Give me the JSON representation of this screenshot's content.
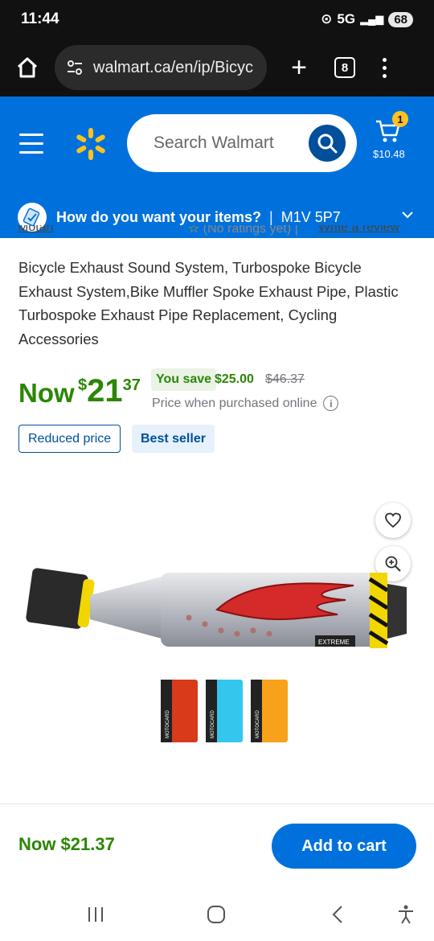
{
  "status": {
    "time": "11:44",
    "network": "5G",
    "battery": "68"
  },
  "browser": {
    "url": "walmart.ca/en/ip/Bicyc",
    "tab_count": "8"
  },
  "header": {
    "search_placeholder": "Search Walmart",
    "cart_count": "1",
    "cart_total": "$10.48",
    "brand_color": "#0071dc",
    "accent_color": "#ffc220"
  },
  "delivery": {
    "question": "How do you want your items?",
    "postal_code": "M1V 5P7"
  },
  "clipped_row": {
    "brand": "Motah",
    "ratings": "(No ratings yet)",
    "review_link": "Write a review"
  },
  "product": {
    "title": "Bicycle Exhaust Sound System, Turbospoke Bicycle Exhaust System,Bike Muffler Spoke Exhaust Pipe, Plastic Turbospoke Exhaust Pipe Replacement, Cycling Accessories",
    "now_label": "Now",
    "currency": "$",
    "price_whole": "21",
    "price_cents": "37",
    "you_save_label": "You save",
    "save_amount": "$25.00",
    "was_price": "$46.37",
    "price_note": "Price when purchased online",
    "badges": [
      "Reduced price",
      "Best seller"
    ],
    "price_color": "#2a8703",
    "decal_text": "EXTREME",
    "card_label": "MOTOCARD"
  },
  "bottom_bar": {
    "price_text": "Now $21.37",
    "add_to_cart": "Add to cart"
  }
}
